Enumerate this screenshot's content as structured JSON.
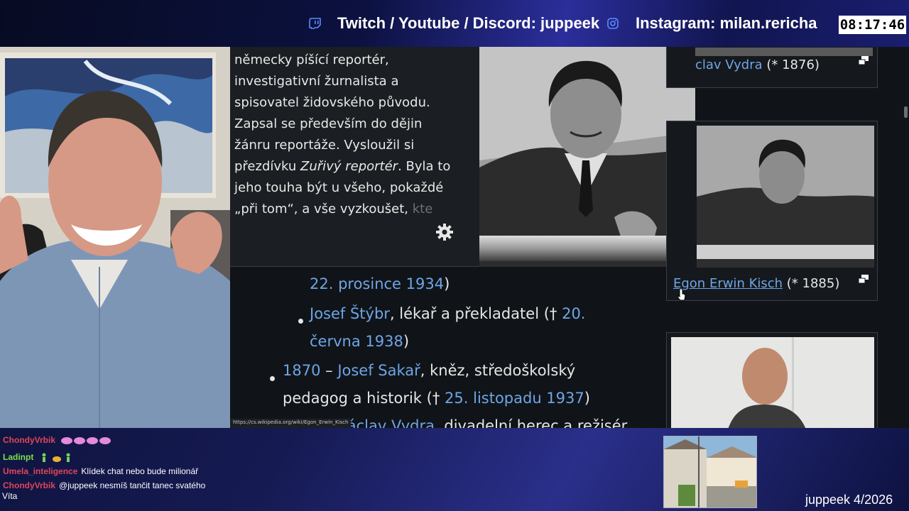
{
  "banner": {
    "social_text": "Twitch / Youtube / Discord: juppeek",
    "instagram_text": "Instagram: milan.rericha",
    "clock": "08:17:46",
    "icons": [
      "twitch-icon",
      "instagram-icon"
    ]
  },
  "popup": {
    "lines": [
      "německy píšící reportér,",
      "investigativní žurnalista a",
      "spisovatel židovského původu.",
      "Zapsal se především do dějin",
      "žánru reportáže. Vysloužil si"
    ],
    "line6_pre": "přezdívku ",
    "line6_italic": "Zuřivý reportér",
    "line6_post": ". Byla to",
    "line7": "jeho touha být u všeho, pokaždé",
    "line8_pre": "„při tom“, a vše vyzkoušet, ",
    "line8_fade": "kte",
    "settings_icon": "gear-icon"
  },
  "article": {
    "l1_link": "22. prosince 1934",
    "l1_post": ")",
    "l2_link": "Josef Štýbr",
    "l2_mid": ", lékař a překladatel († ",
    "l2_link2": "20.",
    "l3_link": "června 1938",
    "l3_post": ")",
    "l4_link": "1870",
    "l4_dash": " – ",
    "l4_link2": "Josef Sakař",
    "l4_post": ", kněz, středoškolský",
    "l5_pre": "pedagog a historik († ",
    "l5_link": "25. listopadu 1937",
    "l5_post": ")",
    "l6_link": "Václav Vydra",
    "l6_post": ", divadelní herec a režisér"
  },
  "sidebar": {
    "card1_link": "clav Vydra",
    "card1_post": " (* 1876)",
    "card2_link": "Egon Erwin Kisch",
    "card2_post": " (* 1885)"
  },
  "status_url": "https://cs.wikipedia.org/wiki/Egon_Erwin_Kisch",
  "chat": [
    {
      "user": "ChondyVrbik",
      "color": "#e0455a",
      "text": ""
    },
    {
      "user": "Ladinpt",
      "color": "#7be04a",
      "text": ""
    },
    {
      "user": "Umela_inteligence",
      "color": "#e0455a",
      "text": "Klídek chat nebo bude milionář"
    },
    {
      "user": "ChondyVrbik",
      "color": "#e0455a",
      "text": "@juppeek nesmíš tančit tanec svatého"
    },
    {
      "user": "",
      "color": "#ffffff",
      "text": "Víta"
    }
  ],
  "channel_tag": "juppeek 4/2026"
}
